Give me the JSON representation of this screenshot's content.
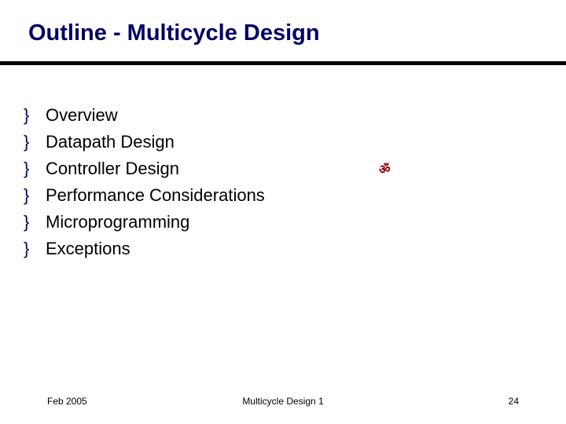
{
  "title": "Outline - Multicycle Design",
  "bullet_glyph": "}",
  "items": [
    {
      "text": "Overview"
    },
    {
      "text": "Datapath Design"
    },
    {
      "text": "Controller Design"
    },
    {
      "text": "Performance Considerations"
    },
    {
      "text": "Microprogramming"
    },
    {
      "text": "Exceptions"
    }
  ],
  "marker_glyph": "ॐ",
  "footer": {
    "left": "Feb 2005",
    "center": "Multicycle Design 1",
    "right": "24"
  }
}
